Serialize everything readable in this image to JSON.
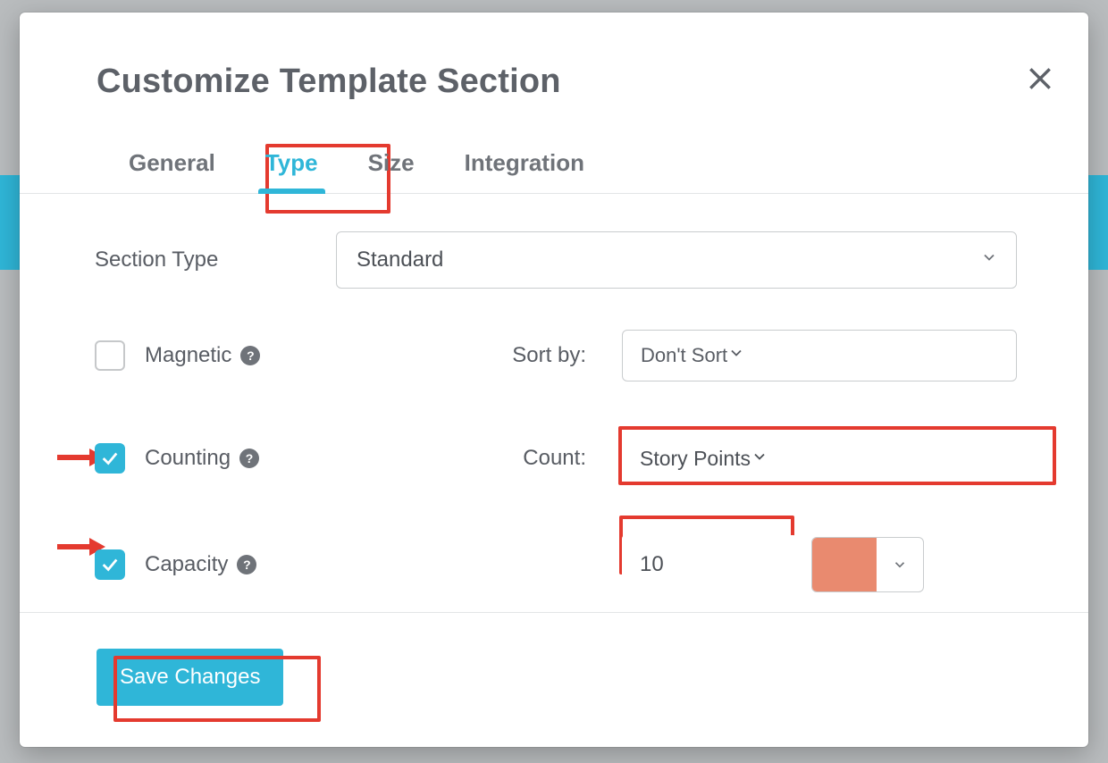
{
  "modal": {
    "title": "Customize Template Section",
    "tabs": {
      "general": "General",
      "type": "Type",
      "size": "Size",
      "integration": "Integration",
      "active": "type"
    },
    "sectionType": {
      "label": "Section Type",
      "value": "Standard"
    },
    "magnetic": {
      "label": "Magnetic",
      "checked": false,
      "sort_label": "Sort by:",
      "sort_value": "Don't Sort"
    },
    "counting": {
      "label": "Counting",
      "checked": true,
      "count_label": "Count:",
      "count_value": "Story Points"
    },
    "capacity": {
      "label": "Capacity",
      "checked": true,
      "value": "10",
      "color": "#e98a6f"
    },
    "save_label": "Save Changes"
  },
  "help_glyph": "?"
}
